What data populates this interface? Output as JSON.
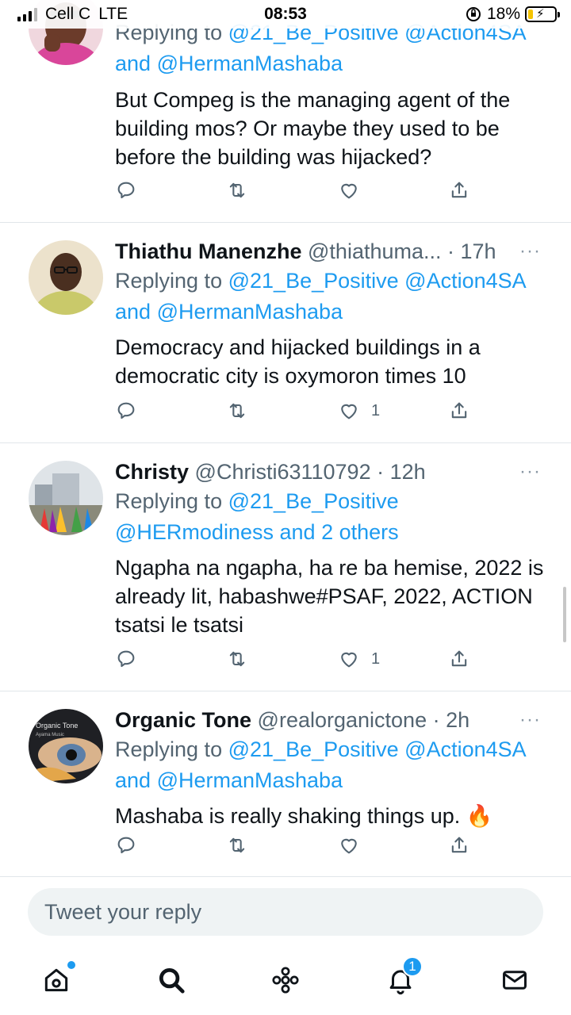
{
  "status_bar": {
    "carrier": "Cell C",
    "network": "LTE",
    "time": "08:53",
    "battery": "18%",
    "battery_level": 0.18
  },
  "tweets": [
    {
      "name": "",
      "handle": "",
      "time": "",
      "reply_prefix": "Replying to",
      "mention1": "@21_Be_Positive",
      "mention2": "@Action4SA",
      "reply_and": "and",
      "mention3": "@HermanMashaba",
      "text": "But Compeg is the managing agent of the building mos? Or maybe they used to be before the building was hijacked?",
      "likes": ""
    },
    {
      "name": "Thiathu Manenzhe",
      "handle": "@thiathuma...",
      "time": "· 17h",
      "reply_prefix": "Replying to",
      "mention1": "@21_Be_Positive",
      "mention2": "@Action4SA",
      "reply_and": "and",
      "mention3": "@HermanMashaba",
      "text": "Democracy and hijacked buildings in a democratic city is oxymoron times 10",
      "likes": "1"
    },
    {
      "name": "Christy",
      "handle": "@Christi63110792",
      "time": "· 12h",
      "reply_prefix": "Replying to",
      "mention1": "@21_Be_Positive",
      "mention2": "@HERmodiness",
      "reply_and": "and",
      "mention3": "2 others",
      "text": "Ngapha na ngapha, ha re ba hemise, 2022 is already lit, habashwe#PSAF, 2022, ACTION tsatsi le tsatsi",
      "likes": "1"
    },
    {
      "name": "Organic Tone",
      "handle": "@realorganictone",
      "time": "· 2h",
      "reply_prefix": "Replying to",
      "mention1": "@21_Be_Positive",
      "mention2": "@Action4SA",
      "reply_and": "and",
      "mention3": "@HermanMashaba",
      "text": "Mashaba is really shaking things up. 🔥",
      "likes": "",
      "avatar_label": "Organic Tone",
      "avatar_sublabel": "Ayama Music"
    }
  ],
  "reply_placeholder": "Tweet your reply",
  "more_glyph": "···",
  "nav": {
    "notification_count": "1"
  },
  "colors": {
    "accent": "#1d9bf0",
    "secondary_text": "#536471",
    "primary_text": "#0f1419",
    "divider": "#e1e6ea"
  },
  "icons": [
    "comment-icon",
    "retweet-icon",
    "like-icon",
    "share-icon",
    "home-icon",
    "search-icon",
    "spaces-icon",
    "bell-icon",
    "mail-icon"
  ]
}
